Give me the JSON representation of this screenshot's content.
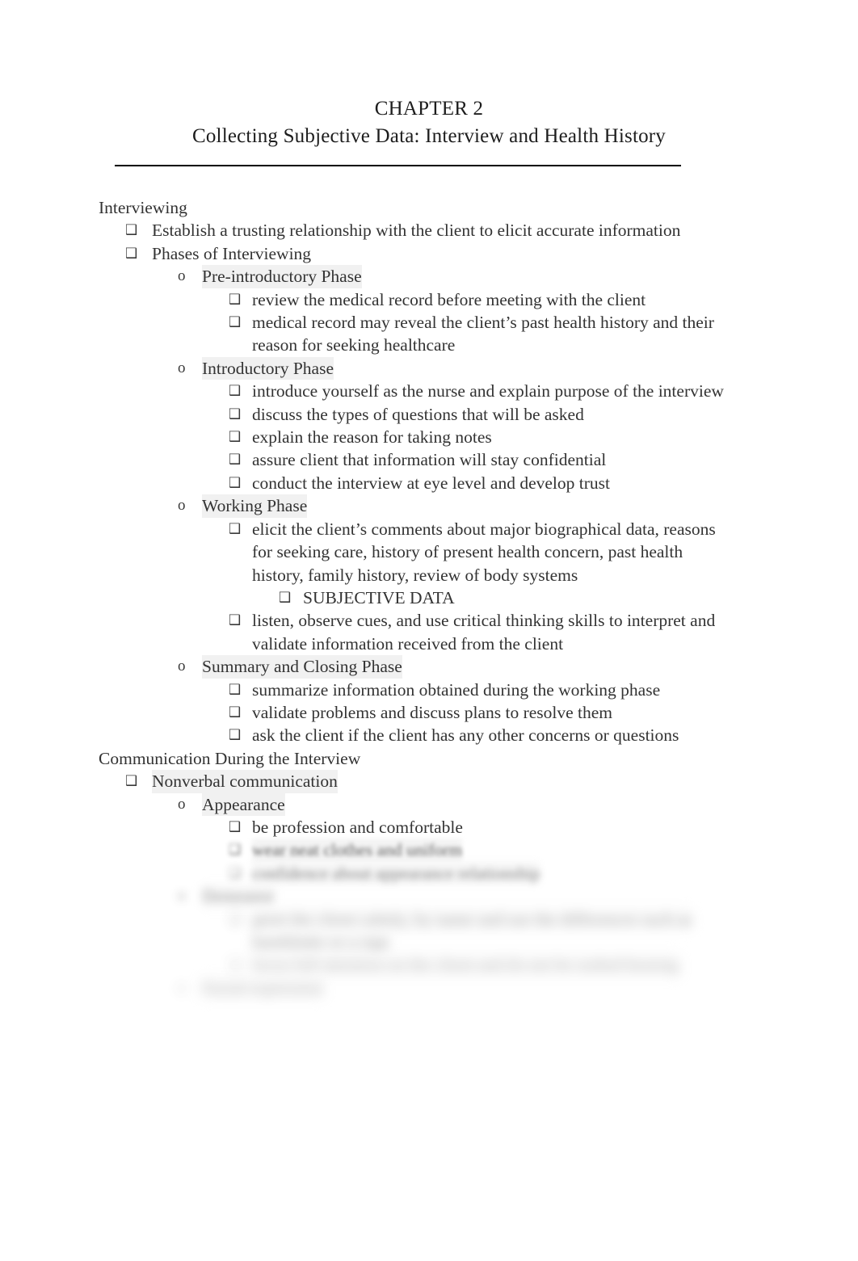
{
  "document": {
    "title_line_1": "CHAPTER 2",
    "title_line_2": "Collecting Subjective Data: Interview and Health History",
    "bullet_glyph": "❑",
    "sublevel_glyph": "o"
  },
  "outline": {
    "interviewing_heading": "Interviewing",
    "establish_trust": "Establish a trusting relationship with the client to elicit accurate information",
    "phases_heading": "Phases of Interviewing",
    "pre_intro_phase": "Pre-introductory Phase",
    "pre_intro_b1": "review the medical record before meeting with the client",
    "pre_intro_b2_a": "medical record may reveal the client’s past health history and their",
    "pre_intro_b2_b": "reason for seeking healthcare",
    "intro_phase": "Introductory Phase",
    "intro_b1": "introduce yourself as the nurse and explain purpose of the interview",
    "intro_b2": "discuss the types of questions that will be asked",
    "intro_b3": "explain the reason for taking notes",
    "intro_b4": "assure client that information will stay confidential",
    "intro_b5": "conduct the interview at eye level and develop trust",
    "working_phase": "Working Phase",
    "working_b1_a": "elicit the client’s comments about major biographical data, reasons",
    "working_b1_b": "for seeking care, history of present health concern, past health",
    "working_b1_c": "history, family history, review of body systems",
    "working_b1_sub": "SUBJECTIVE DATA",
    "working_b2_a": "listen, observe cues, and use critical thinking skills to interpret and",
    "working_b2_b": "validate information received from the client",
    "summary_phase": "Summary and Closing Phase",
    "summary_b1": "summarize information obtained during the working phase",
    "summary_b2": "validate problems and discuss plans to resolve them",
    "summary_b3": "ask the client if the client has any other concerns or questions",
    "communication_heading": "Communication During the Interview",
    "nonverbal_heading": "Nonverbal communication",
    "appearance_heading": "Appearance",
    "appearance_b1": "be profession and comfortable",
    "appearance_b2": "wear neat clothes and uniform",
    "appearance_b3": "confidence about appearance relationship",
    "demeanor_heading": "Demeanor",
    "demeanor_b1_a": "greet the client calmly, by name and use the differences such as",
    "demeanor_b1_b": "handshake or a sign",
    "demeanor_b2": "focus full attention on the client and do not be rushed hearing",
    "facial_expression_heading": "Facial expression"
  }
}
